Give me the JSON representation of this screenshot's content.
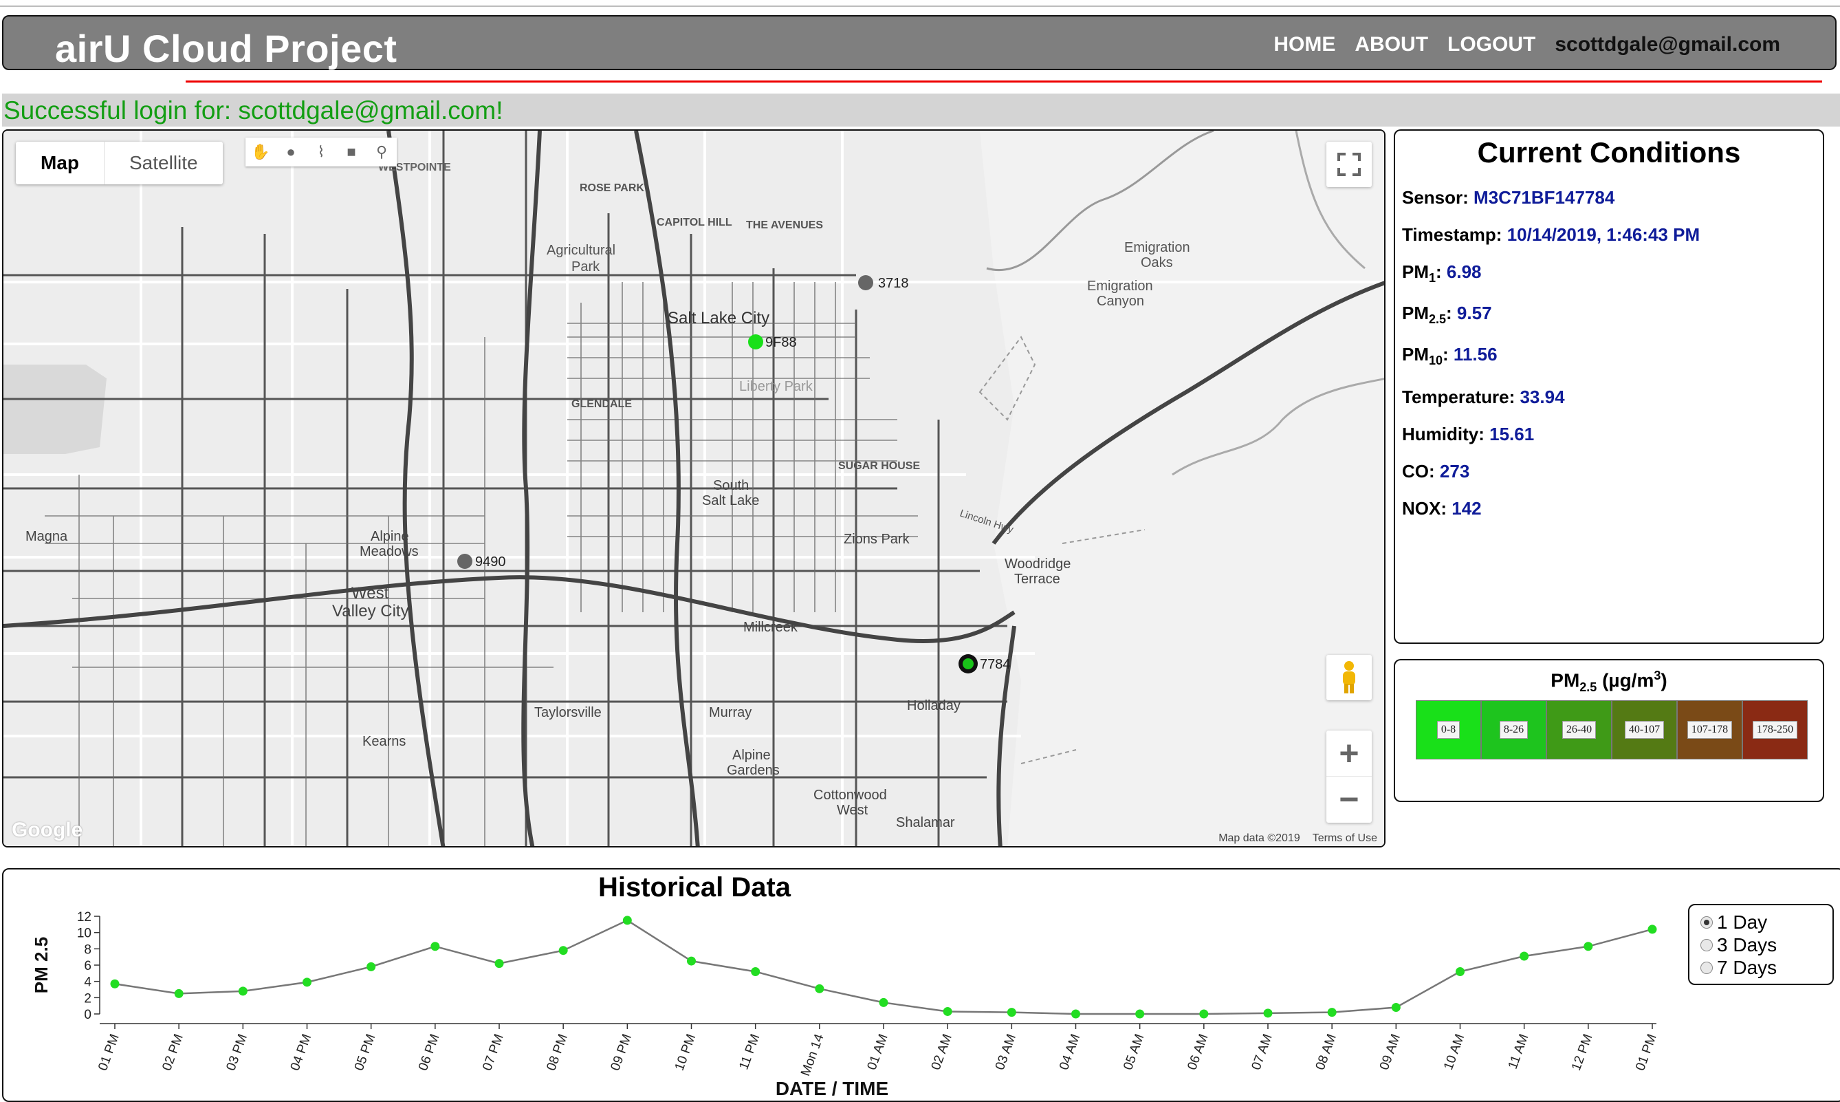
{
  "header": {
    "title": "airU Cloud Project",
    "nav": [
      "HOME",
      "ABOUT",
      "LOGOUT"
    ],
    "user_email": "scottdgale@gmail.com"
  },
  "flash_message": "Successful login for: scottdgale@gmail.com!",
  "map": {
    "type_buttons": [
      "Map",
      "Satellite"
    ],
    "active_type": "Map",
    "draw_tools": [
      "hand-icon",
      "circle-icon",
      "polyline-icon",
      "rectangle-icon",
      "marker-icon"
    ],
    "labels": [
      "WESTPOINTE",
      "ROSE PARK",
      "CAPITOL HILL",
      "THE AVENUES",
      "Agricultural Park",
      "Salt Lake City",
      "Liberty Park",
      "GLENDALE",
      "SUGAR HOUSE",
      "South Salt Lake",
      "Emigration Oaks",
      "Emigration Canyon",
      "Magna",
      "Alpine Meadows",
      "West Valley City",
      "Zions Park",
      "Woodridge Terrace",
      "Millcreek",
      "Taylorsville",
      "Murray",
      "Holladay",
      "Kearns",
      "Alpine Gardens",
      "Cottonwood West",
      "Shalamar",
      "Lincoln Hwy"
    ],
    "sensors": [
      {
        "id": "3718",
        "color": "#666666"
      },
      {
        "id": "9F88",
        "color": "#19e019"
      },
      {
        "id": "9490",
        "color": "#666666"
      },
      {
        "id": "7784",
        "color": "#19c419",
        "selected": true
      }
    ],
    "attribution": [
      "Map data ©2019",
      "Terms of Use"
    ],
    "logo": "Google"
  },
  "current_conditions": {
    "title": "Current Conditions",
    "sensor_label": "Sensor:",
    "sensor": "M3C71BF147784",
    "timestamp_label": "Timestamp:",
    "timestamp": "10/14/2019, 1:46:43 PM",
    "pm1_label": "PM",
    "pm1_sub": "1",
    "pm1": "6.98",
    "pm25_label": "PM",
    "pm25_sub": "2.5",
    "pm25": "9.57",
    "pm10_label": "PM",
    "pm10_sub": "10",
    "pm10": "11.56",
    "temperature_label": "Temperature:",
    "temperature": "33.94",
    "humidity_label": "Humidity:",
    "humidity": "15.61",
    "co_label": "CO:",
    "co": "273",
    "nox_label": "NOX:",
    "nox": "142"
  },
  "legend": {
    "title_main": "PM",
    "title_sub": "2.5",
    "title_unit": "(µg/m",
    "title_sup": "3",
    "title_close": ")",
    "bins": [
      {
        "label": "0-8",
        "color": "#19e019"
      },
      {
        "label": "8-26",
        "color": "#1ec41e"
      },
      {
        "label": "26-40",
        "color": "#3f9a17"
      },
      {
        "label": "40-107",
        "color": "#547a14"
      },
      {
        "label": "107-178",
        "color": "#7a4a17"
      },
      {
        "label": "178-250",
        "color": "#8a2a14"
      }
    ]
  },
  "historical": {
    "title": "Historical Data",
    "ranges": [
      "1 Day",
      "3 Days",
      "7 Days"
    ],
    "selected_range": "1 Day"
  },
  "chart_data": {
    "type": "line",
    "title": "Historical Data",
    "xlabel": "DATE / TIME",
    "ylabel": "PM 2.5",
    "ylim": [
      0,
      12
    ],
    "yticks": [
      0,
      2,
      4,
      6,
      8,
      10,
      12
    ],
    "categories": [
      "01 PM",
      "02 PM",
      "03 PM",
      "04 PM",
      "05 PM",
      "06 PM",
      "07 PM",
      "08 PM",
      "09 PM",
      "10 PM",
      "11 PM",
      "Mon 14",
      "01 AM",
      "02 AM",
      "03 AM",
      "04 AM",
      "05 AM",
      "06 AM",
      "07 AM",
      "08 AM",
      "09 AM",
      "10 AM",
      "11 AM",
      "12 PM",
      "01 PM"
    ],
    "series": [
      {
        "values": [
          3.7,
          2.5,
          2.8,
          3.9,
          5.8,
          8.3,
          6.2,
          7.8,
          11.5,
          6.5,
          5.2,
          3.1,
          1.4,
          0.3,
          0.2,
          0.0,
          0.0,
          0.0,
          0.1,
          0.2,
          0.8,
          5.2,
          7.1,
          8.3,
          10.4
        ]
      }
    ],
    "line_color": "#777777",
    "point_color": "#22dd22",
    "grid": false
  }
}
